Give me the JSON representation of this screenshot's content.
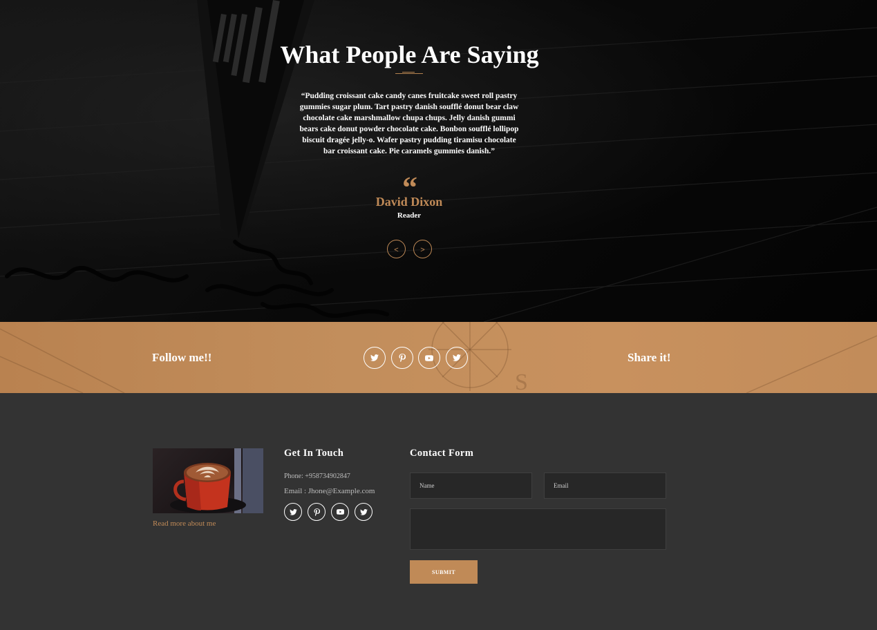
{
  "testimonial": {
    "title": "What People Are Saying",
    "quote": "“Pudding croissant cake candy canes fruitcake sweet roll pastry gummies sugar plum. Tart pastry danish soufflé donut bear claw chocolate cake marshmallow chupa chups. Jelly danish gummi bears cake donut powder chocolate cake. Bonbon soufflé lollipop biscuit dragée jelly-o. Wafer pastry pudding tiramisu chocolate bar croissant cake. Pie caramels gummies danish.”",
    "quote_mark": "“",
    "author": "David Dixon",
    "role": "Reader",
    "prev_label": "<",
    "next_label": ">",
    "accent_color": "#c08a57"
  },
  "follow": {
    "title": "Follow me!!",
    "share_label": "Share it!",
    "icons": [
      "twitter-icon",
      "pinterest-icon",
      "youtube-icon",
      "twitter-icon"
    ],
    "band_color": "#c28e5c"
  },
  "footer": {
    "read_more": "Read more about me",
    "get_in_touch": {
      "title": "Get In Touch",
      "phone": "Phone: +958734902847",
      "email": "Email : Jhone@Example.com",
      "icons": [
        "twitter-icon",
        "pinterest-icon",
        "youtube-icon",
        "twitter-icon"
      ]
    },
    "contact_form": {
      "title": "Contact Form",
      "name_placeholder": "Name",
      "email_placeholder": "Email",
      "message_placeholder": "",
      "submit_label": "SUBMIT"
    },
    "background_color": "#333333"
  }
}
